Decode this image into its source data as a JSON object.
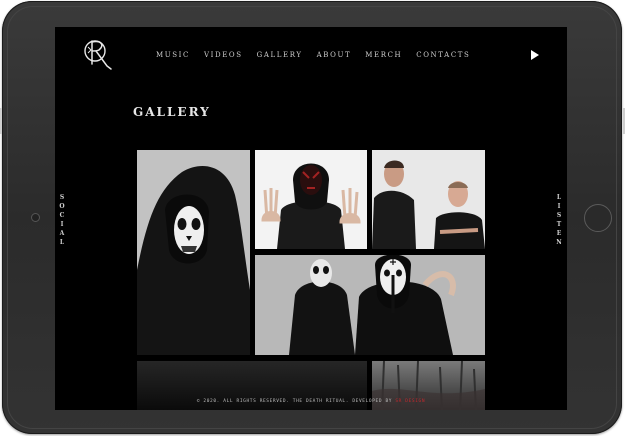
{
  "brand": {
    "logo_text": "R"
  },
  "nav": {
    "items": [
      "Music",
      "Videos",
      "Gallery",
      "About",
      "Merch",
      "Contacts"
    ]
  },
  "page": {
    "title": "Gallery"
  },
  "side": {
    "left": "SOCIAL",
    "right": "LISTEN"
  },
  "footer": {
    "text": "© 2020. All rights reserved. The Death Ritual. Developed by",
    "developer": "SR Design"
  },
  "colors": {
    "background": "#000000",
    "accent": "#c0282d",
    "device": "#2e2e2e"
  },
  "icons": {
    "play": "play-icon",
    "logo": "logo-icon"
  }
}
